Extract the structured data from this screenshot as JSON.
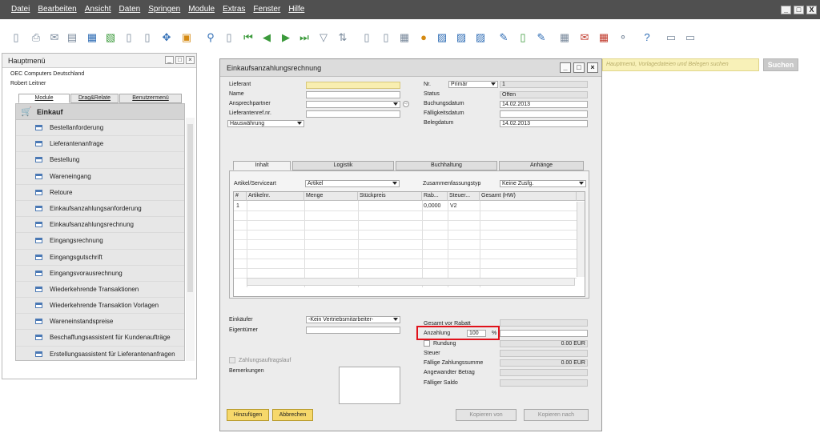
{
  "menubar": {
    "items": [
      "Datei",
      "Bearbeiten",
      "Ansicht",
      "Daten",
      "Springen",
      "Module",
      "Extras",
      "Fenster",
      "Hilfe"
    ],
    "window_controls": [
      "_",
      "□",
      "X"
    ]
  },
  "search": {
    "placeholder": "Hauptmenü, Vorlagedateien und Belegen suchen",
    "button": "Suchen"
  },
  "main_menu": {
    "title": "Hauptmenü",
    "company": "OEC Computers Deutschland",
    "user": "Robert Leitner",
    "tabs": [
      "Module",
      "Drag&Relate",
      "Benutzermenü"
    ],
    "section": "Einkauf",
    "items": [
      "Bestellanforderung",
      "Lieferantenanfrage",
      "Bestellung",
      "Wareneingang",
      "Retoure",
      "Einkaufsanzahlungsanforderung",
      "Einkaufsanzahlungsrechnung",
      "Eingangsrechnung",
      "Eingangsgutschrift",
      "Eingangsvorausrechnung",
      "Wiederkehrende Transaktionen",
      "Wiederkehrende Transaktion Vorlagen",
      "Wareneinstandspreise",
      "Beschaffungsassistent für Kundenaufträge",
      "Erstellungsassistent für Lieferantenanfragen"
    ]
  },
  "dialog": {
    "title": "Einkaufsanzahlungsrechnung",
    "header_left": {
      "lieferant_label": "Lieferant",
      "name_label": "Name",
      "ansprechpartner_label": "Ansprechpartner",
      "lieferantenref_label": "Lieferantenref.nr.",
      "currency_value": "Hauswährung"
    },
    "header_right": {
      "nr_label": "Nr.",
      "nr_series": "Primär",
      "nr_value": "1",
      "status_label": "Status",
      "status_value": "Offen",
      "buchungsdatum_label": "Buchungsdatum",
      "buchungsdatum_value": "14.02.2013",
      "faelligkeitsdatum_label": "Fälligkeitsdatum",
      "faelligkeitsdatum_value": "",
      "belegdatum_label": "Belegdatum",
      "belegdatum_value": "14.02.2013"
    },
    "tabs": [
      "Inhalt",
      "Logistik",
      "Buchhaltung",
      "Anhänge"
    ],
    "content": {
      "artikel_label": "Artikel/Serviceart",
      "artikel_value": "Artikel",
      "zusammenfassung_label": "Zusammenfassungstyp",
      "zusammenfassung_value": "Keine Zusfg.",
      "columns": [
        "#",
        "Artikelnr.",
        "Menge",
        "Stückpreis",
        "Rab...",
        "Steuer...",
        "Gesamt (HW)"
      ],
      "rows": [
        {
          "nr": "1",
          "artikelnr": "",
          "menge": "",
          "stueckpreis": "",
          "rabatt": "0,0000",
          "steuer": "V2",
          "gesamt": ""
        }
      ]
    },
    "footer_left": {
      "einkaeufer_label": "Einkäufer",
      "einkaeufer_value": "-Kein Vertriebsmitarbeiter-",
      "eigentuemer_label": "Eigentümer",
      "zahlungsauftrag_label": "Zahlungsauftragslauf",
      "bemerkungen_label": "Bemerkungen"
    },
    "footer_right": {
      "gesamt_vor_rabatt_label": "Gesamt vor Rabatt",
      "anzahlung_label": "Anzahlung",
      "anzahlung_value": "100",
      "anzahlung_unit": "%",
      "rundung_label": "Rundung",
      "rundung_value": "0.00 EUR",
      "steuer_label": "Steuer",
      "faellige_zahlungssumme_label": "Fällige Zahlungssumme",
      "faellige_zahlungssumme_value": "0.00 EUR",
      "angewandter_betrag_label": "Angewandter Betrag",
      "faelliger_saldo_label": "Fälliger Saldo"
    },
    "buttons": {
      "add": "Hinzufügen",
      "cancel": "Abbrechen",
      "copy_from": "Kopieren von",
      "copy_to": "Kopieren nach"
    }
  },
  "toolbar_icons": [
    "new-document-icon",
    "print-preview-icon",
    "email-icon",
    "export-icon",
    "print-icon",
    "excel-icon",
    "word-icon",
    "pdf-icon",
    "send-icon",
    "lock-icon",
    "find-icon",
    "add-icon",
    "first-record-icon",
    "previous-record-icon",
    "next-record-icon",
    "last-record-icon",
    "filter-icon",
    "sort-icon",
    "base-document-icon",
    "target-document-icon",
    "layout-icon",
    "payment-icon",
    "journal-icon",
    "balance-icon",
    "gross-profit-icon",
    "edit-icon",
    "settings-icon",
    "form-settings-icon",
    "calendar-icon",
    "messages-icon",
    "report-icon",
    "tree-icon",
    "help-icon",
    "minimize-icon",
    "close-all-icon"
  ]
}
